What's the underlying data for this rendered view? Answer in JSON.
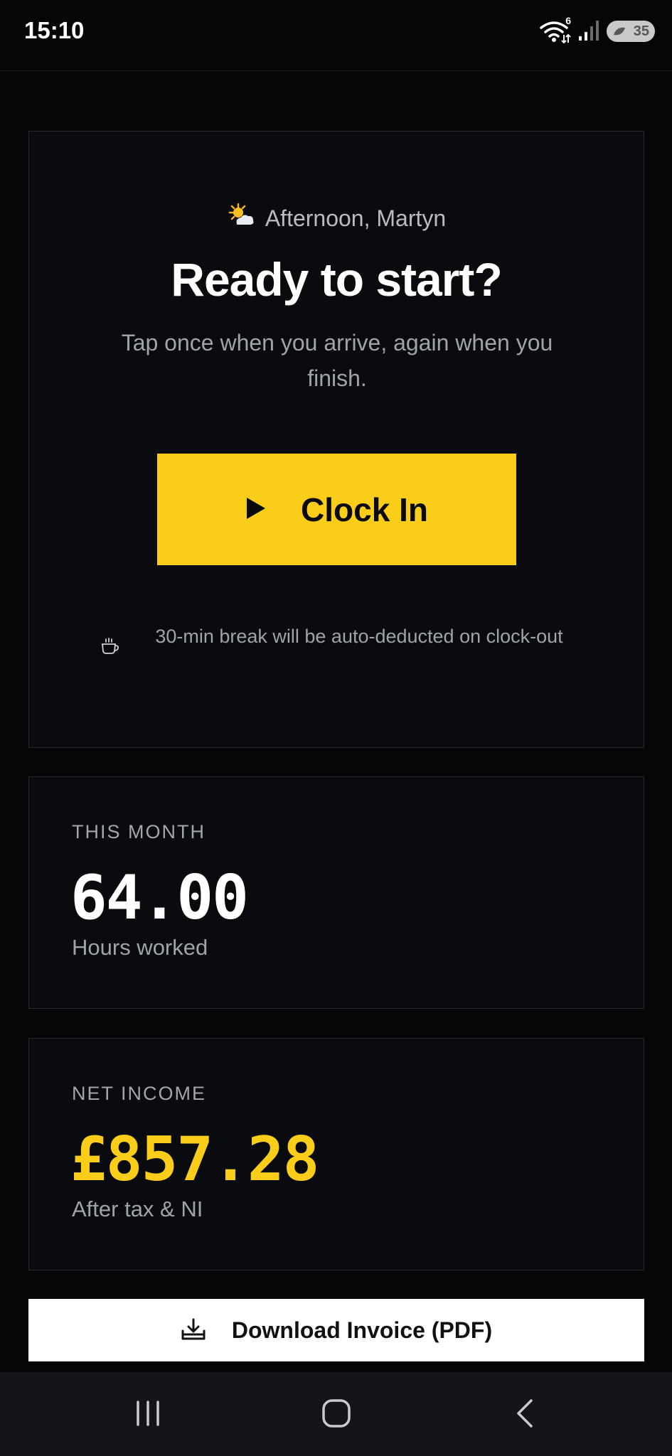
{
  "status_bar": {
    "time": "15:10",
    "wifi_badge": "6",
    "battery_level": "35",
    "icons": [
      "wifi-icon",
      "signal-icon",
      "battery-saver-icon"
    ]
  },
  "hero": {
    "greeting_icon": "sun-behind-cloud-icon",
    "greeting": "Afternoon, Martyn",
    "title": "Ready to start?",
    "subtitle": "Tap once when you arrive, again when you finish.",
    "button_icon": "play-icon",
    "button_label": "Clock In",
    "break_icon": "coffee-cup-icon",
    "break_note": "30-min break will be auto-deducted on clock-out"
  },
  "hours_stat": {
    "label": "THIS MONTH",
    "value": "64.00",
    "caption": "Hours worked"
  },
  "income_stat": {
    "label": "NET INCOME",
    "value": "£857.28",
    "caption": "After tax & NI"
  },
  "download": {
    "icon": "download-tray-icon",
    "label": "Download Invoice (PDF)"
  },
  "nav": {
    "items": [
      "recents-icon",
      "home-icon",
      "back-icon"
    ]
  },
  "colors": {
    "background": "#050607",
    "card": "#0a0b0e",
    "accent": "#f9cd1a",
    "text_muted": "#9fa3aa"
  }
}
